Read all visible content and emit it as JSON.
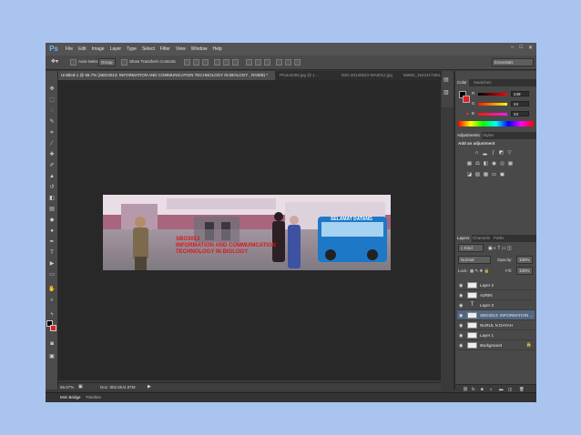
{
  "app": {
    "logo": "Ps"
  },
  "menu": [
    "File",
    "Edit",
    "Image",
    "Layer",
    "Type",
    "Select",
    "Filter",
    "View",
    "Window",
    "Help"
  ],
  "window_controls": {
    "minimize": "–",
    "maximize": "□",
    "close": "✕"
  },
  "options": {
    "auto_select_label": "Auto-Select:",
    "auto_select_value": "Group",
    "show_transform_label": "Show Transform Controls",
    "workspace": "Essentials"
  },
  "tabs": [
    "Untitled-1 @ 66.7% (SBO3013: INFORMATION AND COMMUNICATION TECHNOLOGY IN BIOLOGY , RGB/8) *",
    "Photo0255.jpg @ 1…",
    "IMG-20140523-WA0012.jpg",
    "65893_1542217384…"
  ],
  "banner": {
    "lines": [
      "SBO3013",
      "INFORMATION AND COMMUNICATION",
      "TECHNOLOGY IN BIOLOGY"
    ],
    "bus_text": "SELAMAT DATANG"
  },
  "status": {
    "zoom": "66.67%",
    "doc": "Doc: 902.8K/4.97M"
  },
  "bottom_tabs": [
    "Mini Bridge",
    "Timeline"
  ],
  "color_panel": {
    "tabs": [
      "Color",
      "Swatches"
    ],
    "r_label": "R",
    "g_label": "G",
    "b_label": "B",
    "r": "249",
    "g": "24",
    "b": "24",
    "swatch": "#f91818"
  },
  "adjustments": {
    "tabs": [
      "Adjustments",
      "Styles"
    ],
    "title": "Add an adjustment"
  },
  "layers_panel": {
    "tabs": [
      "Layers",
      "Channels",
      "Paths"
    ],
    "kind": "Kind",
    "blend_mode": "Normal",
    "opacity_label": "Opacity:",
    "opacity": "100%",
    "lock_label": "Lock:",
    "fill_label": "Fill:",
    "fill": "100%",
    "layers": [
      {
        "name": "Layer 2",
        "selected": false,
        "type": "image"
      },
      {
        "name": "AZRIN",
        "selected": false,
        "type": "image"
      },
      {
        "name": "Layer 3",
        "selected": false,
        "type": "text"
      },
      {
        "name": "SBO3013: INFORMATION ...",
        "selected": true,
        "type": "image"
      },
      {
        "name": "NURUL N DAYAH",
        "selected": false,
        "type": "image"
      },
      {
        "name": "Layer 1",
        "selected": false,
        "type": "image"
      },
      {
        "name": "Background",
        "selected": false,
        "type": "image"
      }
    ]
  }
}
